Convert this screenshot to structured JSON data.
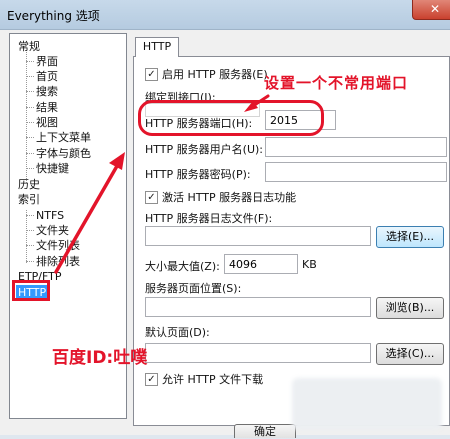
{
  "window": {
    "title": "Everything 选项",
    "close_glyph": "✕"
  },
  "tree": {
    "items": [
      {
        "label": "常规",
        "level": 0
      },
      {
        "label": "界面",
        "level": 1
      },
      {
        "label": "首页",
        "level": 1
      },
      {
        "label": "搜索",
        "level": 1
      },
      {
        "label": "结果",
        "level": 1
      },
      {
        "label": "视图",
        "level": 1
      },
      {
        "label": "上下文菜单",
        "level": 1
      },
      {
        "label": "字体与颜色",
        "level": 1
      },
      {
        "label": "快捷键",
        "level": 1
      },
      {
        "label": "历史",
        "level": 0
      },
      {
        "label": "索引",
        "level": 0
      },
      {
        "label": "NTFS",
        "level": 1
      },
      {
        "label": "文件夹",
        "level": 1
      },
      {
        "label": "文件列表",
        "level": 1
      },
      {
        "label": "排除列表",
        "level": 1
      },
      {
        "label": "ETP/FTP",
        "level": 0
      },
      {
        "label": "HTTP",
        "level": 0,
        "selected": true
      }
    ]
  },
  "tab": {
    "label": "HTTP"
  },
  "form": {
    "enable_http": {
      "label": "启用 HTTP 服务器(E)",
      "checked": true
    },
    "bind_interface": {
      "label": "绑定到接口(I):",
      "value": ""
    },
    "port": {
      "label": "HTTP 服务器端口(H):",
      "value": "2015"
    },
    "username": {
      "label": "HTTP 服务器用户名(U):",
      "value": ""
    },
    "password": {
      "label": "HTTP 服务器密码(P):",
      "value": ""
    },
    "enable_log": {
      "label": "激活 HTTP 服务器日志功能",
      "checked": true
    },
    "log_file": {
      "label": "HTTP 服务器日志文件(F):",
      "value": "",
      "button": "选择(E)..."
    },
    "max_size": {
      "label": "大小最大值(Z):",
      "value": "4096",
      "unit": "KB"
    },
    "page_location": {
      "label": "服务器页面位置(S):",
      "value": "",
      "button": "浏览(B)..."
    },
    "default_page": {
      "label": "默认页面(D):",
      "value": "",
      "button": "选择(C)..."
    },
    "allow_download": {
      "label": "允许 HTTP 文件下载",
      "checked": true
    },
    "check_glyph": "✓"
  },
  "bottom_button": {
    "label": "确定"
  },
  "annotations": {
    "top_note": "设置一个不常用端口",
    "id_note": "百度ID:吐噗"
  },
  "colors": {
    "annotation_red": "#e3142a",
    "selection_blue": "#3399ff"
  }
}
